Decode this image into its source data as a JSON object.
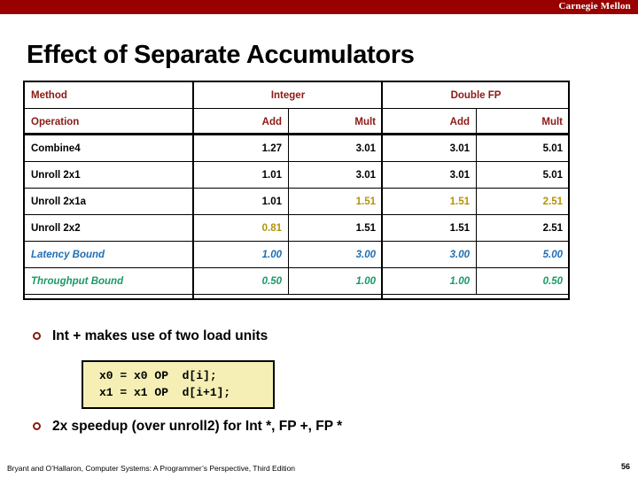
{
  "banner": {
    "brand": "Carnegie Mellon",
    "color": "#990000"
  },
  "slide": {
    "title": "Effect of Separate Accumulators"
  },
  "table": {
    "header_method_label": "Method",
    "group_headers": [
      "Integer",
      "Double FP"
    ],
    "operation_row_label": "Operation",
    "operation_headers": [
      "Add",
      "Mult",
      "Add",
      "Mult"
    ],
    "rows": [
      {
        "method": "Combine4",
        "values": [
          "1.27",
          "3.01",
          "3.01",
          "5.01"
        ]
      },
      {
        "method": "Unroll 2x1",
        "values": [
          "1.01",
          "3.01",
          "3.01",
          "5.01"
        ]
      },
      {
        "method": "Unroll 2x1a",
        "values": [
          "1.01",
          "1.51",
          "1.51",
          "2.51"
        ]
      },
      {
        "method": "Unroll 2x2",
        "values": [
          "0.81",
          "1.51",
          "1.51",
          "2.51"
        ]
      },
      {
        "method": "Latency Bound",
        "values": [
          "1.00",
          "3.00",
          "3.00",
          "5.00"
        ]
      },
      {
        "method": "Throughput Bound",
        "values": [
          "0.50",
          "1.00",
          "1.00",
          "0.50"
        ]
      }
    ],
    "colors": {
      "method_cell_bg": "#d9ead3",
      "bound_cell_bg": "#ccccee",
      "group_header_bg": "#f2c8ca",
      "header_text": "#8b1a14",
      "highlight_gold": "#b2930b",
      "latency_blue": "#1f6fb4",
      "throughput_green": "#1a9966"
    }
  },
  "bullets": [
    {
      "text": "Int + makes use of two load units"
    },
    {
      "text": "2x speedup (over unroll2) for Int *, FP +, FP *"
    }
  ],
  "code": {
    "line1": "x0 = x0 OP  d[i];",
    "line2": "x1 = x1 OP  d[i+1];"
  },
  "footer": {
    "citation": "Bryant and O’Hallaron, Computer Systems: A Programmer’s Perspective, Third Edition",
    "page": "56"
  }
}
